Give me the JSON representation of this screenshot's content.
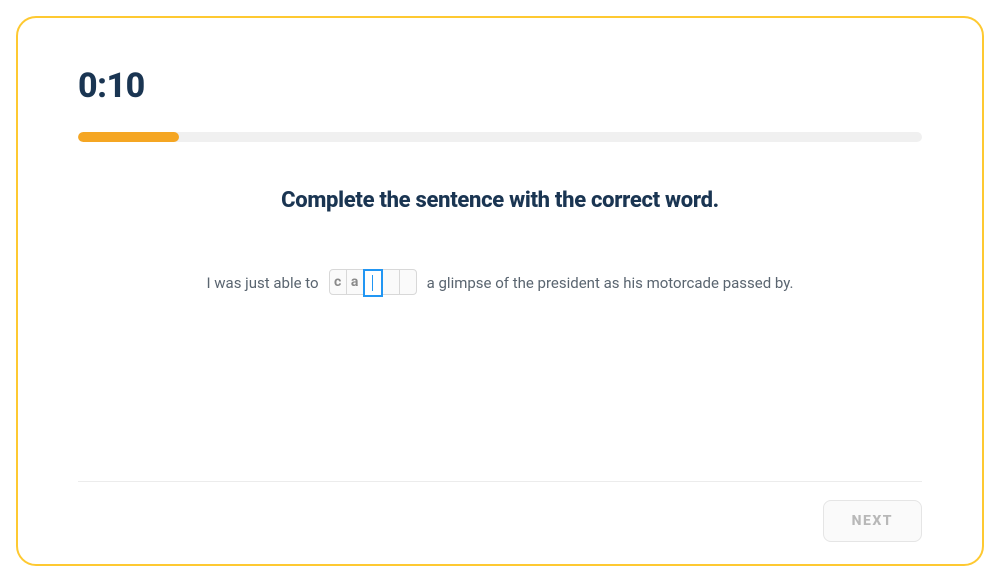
{
  "timer": "0:10",
  "progress_percent": 12,
  "prompt": "Complete the sentence with the correct word.",
  "sentence": {
    "before": "I was just able to",
    "after": "a glimpse of the president as his motorcade passed by."
  },
  "letters": {
    "count": 5,
    "filled": [
      "c",
      "a",
      "",
      "",
      ""
    ],
    "active_index": 2
  },
  "footer": {
    "next_label": "NEXT"
  }
}
